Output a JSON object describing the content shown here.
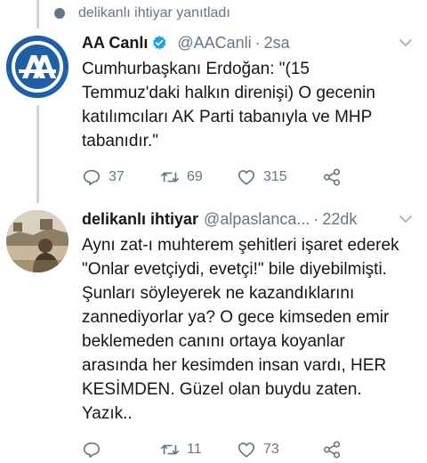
{
  "reply_context": {
    "text": "delikanlı ihtiyar yanıtladı"
  },
  "tweets": [
    {
      "name": "AA Canlı",
      "handle": "@AACanli",
      "time": "2sa",
      "text": "Cumhurbaşkanı Erdoğan: \"(15 Temmuz'daki halkın direnişi) O gecenin katılımcıları AK Parti tabanıyla ve MHP tabanıdır.\"",
      "replies": "37",
      "retweets": "69",
      "likes": "315",
      "avatar_text": "AA",
      "avatar_color": "#1f5fa7"
    },
    {
      "name": "delikanlı ihtiyar",
      "handle": "@alpaslanca...",
      "time": "22dk",
      "text": "Aynı zat-ı muhterem şehitleri işaret ederek \"Onlar evetçiydi, evetçi!\" bile diyebilmişti. Şunları söyleyerek ne kazandıklarını zannediyorlar ya? O gece kimseden emir beklemeden canını ortaya koyanlar arasında her kesimden insan vardı, HER KESİMDEN. Güzel olan buydu zaten. Yazık..",
      "replies": "",
      "retweets": "11",
      "likes": "73"
    }
  ],
  "icons": [
    "reply-icon",
    "retweet-icon",
    "like-icon",
    "share-icon",
    "verified-icon",
    "chevron-down-icon"
  ],
  "colors": {
    "verified": "#1da1f2",
    "secondary_text": "#657786"
  }
}
